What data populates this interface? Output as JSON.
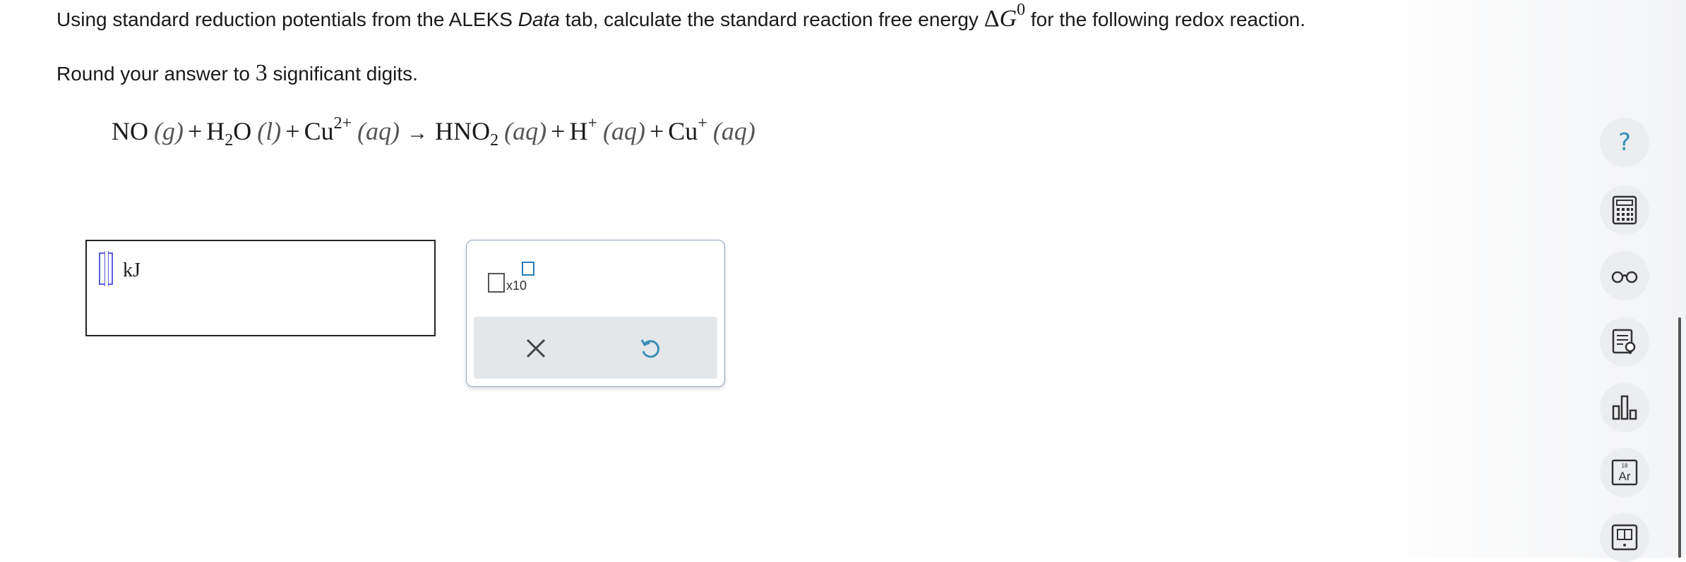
{
  "question": {
    "line1_pre": "Using standard reduction potentials from the ALEKS ",
    "line1_data": "Data",
    "line1_mid": " tab, calculate the standard reaction free energy ",
    "delta": "Δ",
    "G": "G",
    "zero": "0",
    "line1_post": " for the following redox reaction.",
    "line2_pre": "Round your answer to ",
    "sig": "3",
    "line2_post": " significant digits."
  },
  "equation": {
    "r1": "NO",
    "r1_state": "(g)",
    "plus": "+",
    "r2a": "H",
    "r2_sub": "2",
    "r2b": "O",
    "r2_state": "(l)",
    "r3": "Cu",
    "r3_charge": "2+",
    "r3_state": "(aq)",
    "arrow": "→",
    "p1a": "HNO",
    "p1_sub": "2",
    "p1_state": "(aq)",
    "p2": "H",
    "p2_charge": "+",
    "p2_state": "(aq)",
    "p3": "Cu",
    "p3_charge": "+",
    "p3_state": "(aq)"
  },
  "answer": {
    "unit": "kJ",
    "value": ""
  },
  "toolbox": {
    "x10_label": "x10",
    "clear_icon": "close-icon",
    "undo_icon": "undo-icon"
  },
  "sidebar": {
    "help_glyph": "?",
    "icons": [
      "help-icon",
      "calculator-icon",
      "glasses-icon",
      "reference-icon",
      "bar-chart-icon",
      "periodic-table-icon",
      "textbook-icon"
    ],
    "periodic_number": "18",
    "periodic_symbol": "Ar"
  },
  "colors": {
    "accent_blue": "#3a8fb5",
    "cursor_purple": "#5a5ee0",
    "panel_border": "#8aa0b8",
    "action_bar": "#e3e7ea",
    "side_button": "#ecedf0"
  }
}
